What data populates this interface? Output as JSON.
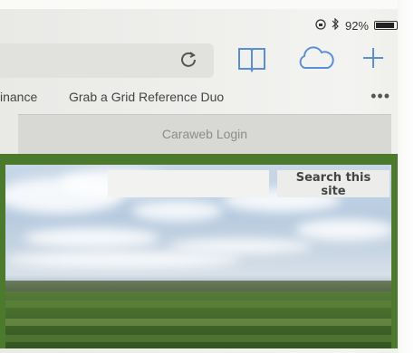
{
  "status_bar": {
    "rotation_lock_icon": "rotation-lock-icon",
    "bluetooth_icon": "bluetooth-icon",
    "battery_percent_label": "92%",
    "battery_level": 0.92
  },
  "toolbar": {
    "reload_icon": "reload-icon",
    "bookmarks_icon": "book-icon",
    "cloud_tabs_icon": "cloud-icon",
    "new_tab_icon": "plus-icon"
  },
  "bookmarks": [
    {
      "label": "inance"
    },
    {
      "label": "Grab a Grid Reference Duo"
    }
  ],
  "more_label": "•••",
  "tab": {
    "title": "Caraweb Login"
  },
  "site": {
    "search_value": "",
    "search_button_label": "Search this site",
    "accent_green": "#4c7a2c"
  }
}
